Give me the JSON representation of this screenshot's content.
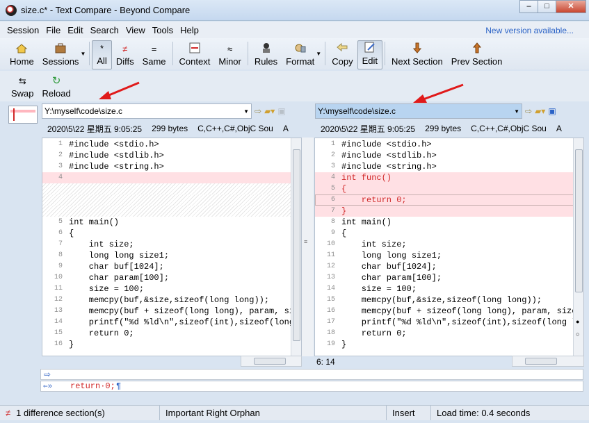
{
  "window": {
    "title": "size.c* - Text Compare - Beyond Compare",
    "controls": [
      "–",
      "□",
      "✕"
    ]
  },
  "menu": {
    "items": [
      "Session",
      "File",
      "Edit",
      "Search",
      "View",
      "Tools",
      "Help"
    ],
    "notice": "New version available..."
  },
  "toolbar": {
    "home": "Home",
    "sessions": "Sessions",
    "all": "All",
    "diffs": "Diffs",
    "same": "Same",
    "context": "Context",
    "minor": "Minor",
    "rules": "Rules",
    "format": "Format",
    "copy": "Copy",
    "edit": "Edit",
    "next_section": "Next Section",
    "prev_section": "Prev Section",
    "icons": {
      "all": "*",
      "diffs": "≠",
      "same": "=",
      "minor": "≈"
    }
  },
  "toolbar2": {
    "swap": "Swap",
    "reload": "Reload"
  },
  "left": {
    "path": "Y:\\myself\\code\\size.c",
    "date": "2020\\5\\22 星期五 9:05:25",
    "size": "299 bytes",
    "format": "C,C++,C#,ObjC Sou",
    "encoding": "A",
    "lines": [
      {
        "n": "1",
        "t": "#include <stdio.h>"
      },
      {
        "n": "2",
        "t": "#include <stdlib.h>"
      },
      {
        "n": "3",
        "t": "#include <string.h>"
      },
      {
        "n": "4",
        "t": ""
      },
      {
        "n": "5",
        "t": "int main()"
      },
      {
        "n": "6",
        "t": "{"
      },
      {
        "n": "7",
        "t": "    int size;"
      },
      {
        "n": "8",
        "t": "    long long size1;"
      },
      {
        "n": "9",
        "t": "    char buf[1024];"
      },
      {
        "n": "10",
        "t": "    char param[100];"
      },
      {
        "n": "11",
        "t": "    size = 100;"
      },
      {
        "n": "12",
        "t": "    memcpy(buf,&size,sizeof(long long));"
      },
      {
        "n": "13",
        "t": "    memcpy(buf + sizeof(long long), param, size"
      },
      {
        "n": "14",
        "t": "    printf(\"%d %ld\\n\",sizeof(int),sizeof(long lo"
      },
      {
        "n": "15",
        "t": "    return 0;"
      },
      {
        "n": "16",
        "t": "}"
      }
    ]
  },
  "right": {
    "path": "Y:\\myself\\code\\size.c",
    "date": "2020\\5\\22 星期五 9:05:25",
    "size": "299 bytes",
    "format": "C,C++,C#,ObjC Sou",
    "encoding": "A",
    "lines": [
      {
        "n": "1",
        "t": "#include <stdio.h>"
      },
      {
        "n": "2",
        "t": "#include <stdlib.h>"
      },
      {
        "n": "3",
        "t": "#include <string.h>"
      },
      {
        "n": "4",
        "t": "int func()"
      },
      {
        "n": "5",
        "t": "{"
      },
      {
        "n": "6",
        "t": "    return 0;"
      },
      {
        "n": "7",
        "t": "}"
      },
      {
        "n": "8",
        "t": "int main()"
      },
      {
        "n": "9",
        "t": "{"
      },
      {
        "n": "10",
        "t": "    int size;"
      },
      {
        "n": "11",
        "t": "    long long size1;"
      },
      {
        "n": "12",
        "t": "    char buf[1024];"
      },
      {
        "n": "13",
        "t": "    char param[100];"
      },
      {
        "n": "14",
        "t": "    size = 100;"
      },
      {
        "n": "15",
        "t": "    memcpy(buf,&size,sizeof(long long));"
      },
      {
        "n": "16",
        "t": "    memcpy(buf + sizeof(long long), param, size"
      },
      {
        "n": "17",
        "t": "    printf(\"%d %ld\\n\",sizeof(int),sizeof(long l"
      },
      {
        "n": "18",
        "t": "    return 0;"
      },
      {
        "n": "19",
        "t": "}"
      }
    ]
  },
  "cursor_pos": "6: 14",
  "line_detail": {
    "text": "return·0;",
    "pilcrow": "¶",
    "prefix": "⇐»"
  },
  "status": {
    "diff": "1 difference section(s)",
    "diff_icon": "≠",
    "orphan": "Important Right Orphan",
    "mode": "Insert",
    "load": "Load time: 0.4 seconds"
  },
  "colors": {
    "diff_bg": "#ffe0e4",
    "diff_text": "#d12828",
    "accent": "#2a62c6"
  }
}
